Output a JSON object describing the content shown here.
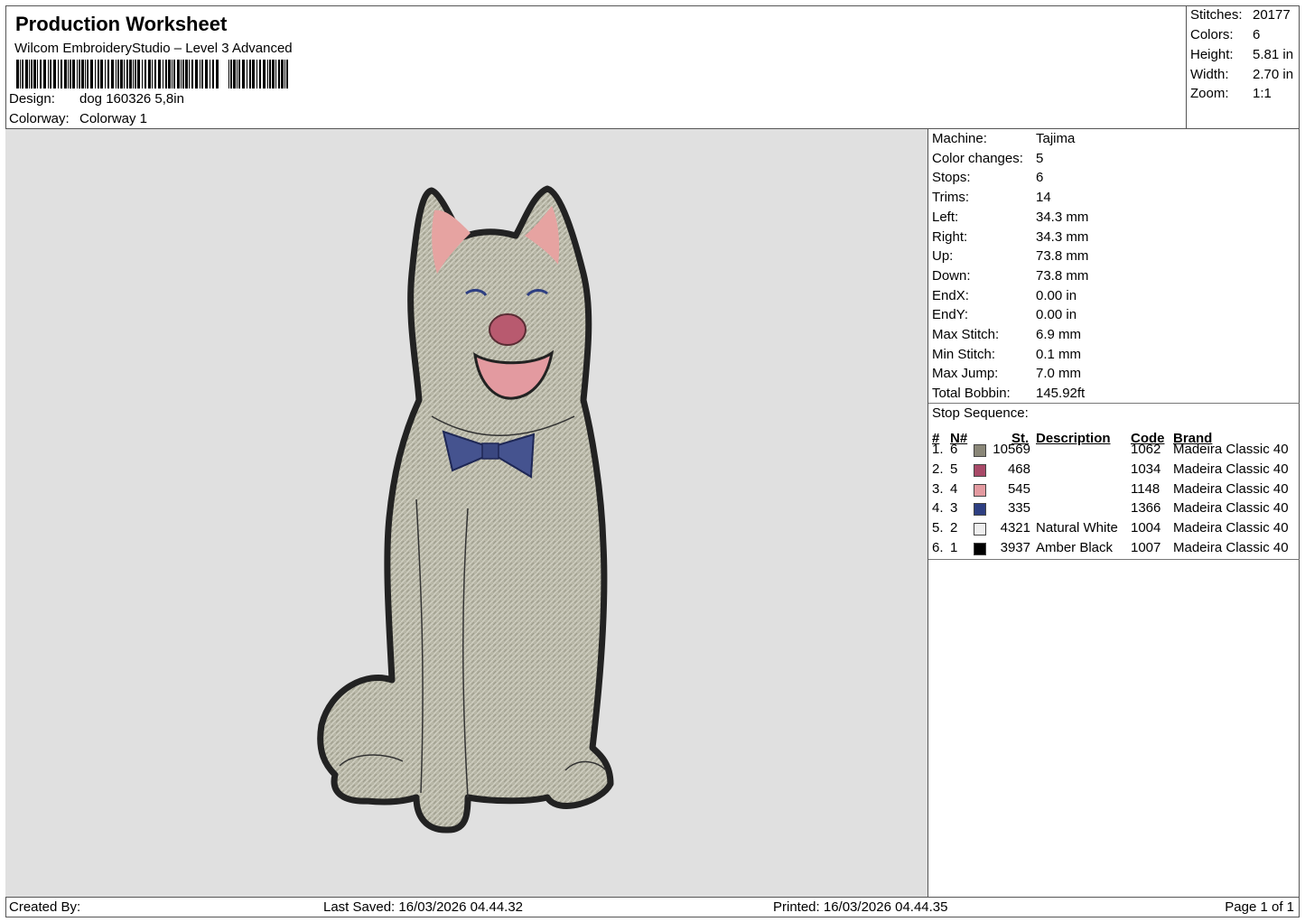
{
  "header": {
    "title": "Production Worksheet",
    "software": "Wilcom EmbroideryStudio – Level 3 Advanced",
    "design_label": "Design:",
    "design_value": "dog 160326 5,8in",
    "colorway_label": "Colorway:",
    "colorway_value": "Colorway 1"
  },
  "summary": [
    {
      "label": "Stitches:",
      "value": "20177"
    },
    {
      "label": "Colors:",
      "value": "6"
    },
    {
      "label": "Height:",
      "value": "5.81 in"
    },
    {
      "label": "Width:",
      "value": "2.70 in"
    },
    {
      "label": "Zoom:",
      "value": "1:1"
    }
  ],
  "machine_info": [
    {
      "label": "Machine:",
      "value": "Tajima"
    },
    {
      "label": "Color changes:",
      "value": "5"
    },
    {
      "label": "Stops:",
      "value": "6"
    },
    {
      "label": "Trims:",
      "value": "14"
    },
    {
      "label": "Left:",
      "value": "34.3 mm"
    },
    {
      "label": "Right:",
      "value": "34.3 mm"
    },
    {
      "label": "Up:",
      "value": "73.8 mm"
    },
    {
      "label": "Down:",
      "value": "73.8 mm"
    },
    {
      "label": "EndX:",
      "value": "0.00 in"
    },
    {
      "label": "EndY:",
      "value": "0.00 in"
    },
    {
      "label": "Max Stitch:",
      "value": "6.9 mm"
    },
    {
      "label": "Min Stitch:",
      "value": "0.1 mm"
    },
    {
      "label": "Max Jump:",
      "value": "7.0 mm"
    },
    {
      "label": "Total Bobbin:",
      "value": "145.92ft"
    }
  ],
  "stop_sequence": {
    "title": "Stop Sequence:",
    "headers": {
      "num": "#",
      "n": "N#",
      "st": "St.",
      "description": "Description",
      "code": "Code",
      "brand": "Brand"
    },
    "rows": [
      {
        "num": "1.",
        "n": "6",
        "color": "#8a8778",
        "st": "10569",
        "description": "",
        "code": "1062",
        "brand": "Madeira Classic 40"
      },
      {
        "num": "2.",
        "n": "5",
        "color": "#a84a68",
        "st": "468",
        "description": "",
        "code": "1034",
        "brand": "Madeira Classic 40"
      },
      {
        "num": "3.",
        "n": "4",
        "color": "#e39aa0",
        "st": "545",
        "description": "",
        "code": "1148",
        "brand": "Madeira Classic 40"
      },
      {
        "num": "4.",
        "n": "3",
        "color": "#2e3f82",
        "st": "335",
        "description": "",
        "code": "1366",
        "brand": "Madeira Classic 40"
      },
      {
        "num": "5.",
        "n": "2",
        "color": "#efefef",
        "st": "4321",
        "description": "Natural White",
        "code": "1004",
        "brand": "Madeira Classic 40"
      },
      {
        "num": "6.",
        "n": "1",
        "color": "#000000",
        "st": "3937",
        "description": "Amber Black",
        "code": "1007",
        "brand": "Madeira Classic 40"
      }
    ]
  },
  "footer": {
    "created_by": "Created By:",
    "last_saved": "Last Saved: 16/03/2026 04.44.32",
    "printed": "Printed: 16/03/2026 04.44.35",
    "page": "Page 1 of 1"
  }
}
